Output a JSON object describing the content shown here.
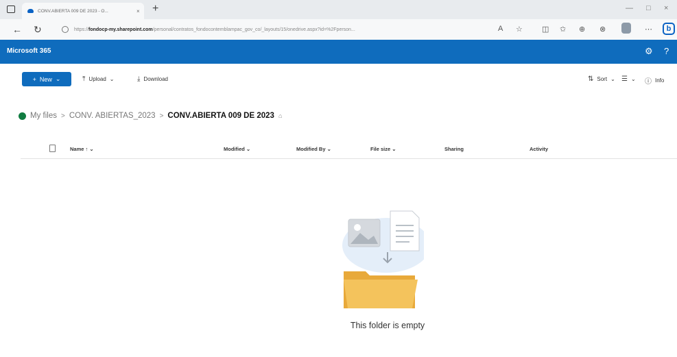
{
  "browser": {
    "tab_title": "CONV.ABIERTA 009 DE 2023 - O...",
    "tab_close": "×",
    "newtab": "+",
    "minimize": "—",
    "maximize": "□",
    "close": "×",
    "url_prefix": "https://",
    "url_domain": "fondocp-my.sharepoint.com",
    "url_path": "/personal/contratos_fondocontemblampac_gov_co/_layouts/15/onedrive.aspx?id=%2Fperson...",
    "back": "←",
    "reload": "↻",
    "toolbar_icons": [
      "A",
      "☆",
      "◫",
      "✩",
      "⊕",
      "⊗",
      "⋯"
    ],
    "bing_label": "b"
  },
  "suite": {
    "brand": "Microsoft 365",
    "settings_glyph": "⚙",
    "help_glyph": "?"
  },
  "commands": {
    "new": "New",
    "new_plus": "+",
    "chevron": "⌄",
    "upload": "Upload",
    "upload_glyph": "⤒",
    "download": "Download",
    "download_glyph": "⤓",
    "sort": "Sort",
    "sort_glyph": "⇅",
    "view_glyph": "☰",
    "info": "Info",
    "info_glyph": "ⓘ"
  },
  "breadcrumb": {
    "items": [
      "My files",
      "CONV. ABIERTAS_2023",
      "CONV.ABIERTA 009 DE 2023"
    ],
    "separator": ">",
    "share_glyph": "⌂"
  },
  "columns": {
    "name": "Name",
    "name_sort": "↑ ⌄",
    "modified": "Modified",
    "modified_by": "Modified By",
    "file_size": "File size",
    "sharing": "Sharing",
    "activity": "Activity",
    "chevron": "⌄"
  },
  "empty_state": {
    "message": "This folder is empty"
  },
  "colors": {
    "accent": "#0f6cbd",
    "folder": "#f4c35c"
  }
}
